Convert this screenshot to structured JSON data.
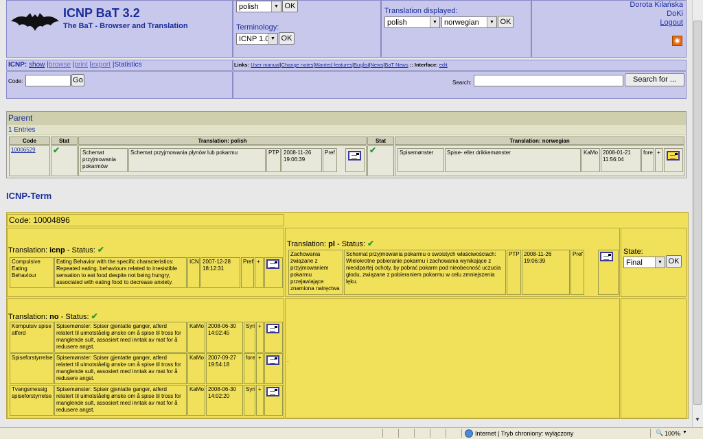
{
  "header": {
    "title": "ICNP BaT 3.2",
    "subtitle": "The BaT - Browser and Translation",
    "lang_select": "polish",
    "ok": "OK",
    "terminology_label": "Terminology:",
    "terminology_select": "ICNP 1.0",
    "translation_label": "Translation displayed:",
    "trans_sel1": "polish",
    "trans_sel2": "norwegian",
    "user_name": "Dorota Kilańska",
    "user_short": "DoKi",
    "logout": "Logout"
  },
  "nav": {
    "icnp": "ICNP:",
    "show": "show",
    "browse": "browse",
    "print": "print",
    "export": "export",
    "statistics": "Statistics",
    "links_label": "Links:",
    "user_manual": "User manual",
    "change_notes": "Change notes",
    "wanted": "Wanted features",
    "buglist": "Buglist",
    "news": "News",
    "bat_news": "BaT News",
    "interface_label": "Interface:",
    "edit": "edit",
    "sep": "|",
    "sep2": "::"
  },
  "search": {
    "code_label": "Code:",
    "go": "Go",
    "search_label": "Search:",
    "search_btn": "Search for ..."
  },
  "parent": {
    "title": "Parent",
    "entries": "1 Entries",
    "col_code": "Code",
    "col_stat": "Stat",
    "col_trans_pl": "Translation: polish",
    "col_trans_no": "Translation: norwegian",
    "code": "10006529",
    "pl": {
      "term": "Schemat przyjmowania pokarmów",
      "def": "Schemat przyjmowania płynów lub pokarmu",
      "user": "PTP",
      "date": "2008-11-26 19:06:39",
      "type": "Pref"
    },
    "no": {
      "term": "Spisemønster",
      "def": "Spise- eller drikkemønster",
      "user": "KaMo",
      "date": "2008-01-21 11:56:04",
      "type": "fore",
      "plus": "+"
    }
  },
  "term": {
    "heading": "ICNP-Term",
    "code_label": "Code: 10004896",
    "state_label": "State:",
    "state_value": "Final",
    "ok": "OK",
    "status": "- Status:",
    "dot": ".",
    "icnp": {
      "prefix": "Translation:",
      "lang": "icnp",
      "term": "Compulsive Eating Behaviour",
      "def": "Eating Behavior with the specific characteristics: Repeated eating, behaviours related to irresistible sensation to eat food despite not being hungry, associated with eating food to decrease anxiety.",
      "user": "ICN",
      "date": "2007-12-28 18:12:31",
      "type": "Pref",
      "plus": "+"
    },
    "pl": {
      "prefix": "Translation:",
      "lang": "pl",
      "term": "Zachowania związane z przyjmowaniem pokarmu przejawiające znamiona natręctwa",
      "def": "Schemat przyjmowania pokarmu o swoistych właściwościach: Wielokrotne pobieranie pokarmu i zachowania wynikające z nieodpartej ochoty, by pobrać pokarm pod nieobecność uczucia głodu, związane z pobieraniem pokarmu w celu zmniejszenia lęku.",
      "user": "PTP",
      "date": "2008-11-26 19:06:39",
      "type": "Pref"
    },
    "no": {
      "prefix": "Translation:",
      "lang": "no",
      "rows": [
        {
          "term": "Kompulsiv spise atferd",
          "def": "Spisemønster: Spiser gjentatte ganger, atferd relatert til uimotståelig ønske om å spise til tross for manglende sult, assosiert med inntak av mat for å redusere angst.",
          "user": "KaMo",
          "date": "2008-06-30 14:02:45",
          "type": "Syn",
          "plus": "+"
        },
        {
          "term": "Spiseforstyrrelser",
          "def": "Spisemønster: Spiser gjentatte ganger, atferd relatert til uimotståelig ønske om å spise til tross for manglende sult, assosiert med inntak av mat for å redusere angst.",
          "user": "KaMo",
          "date": "2007-09-27 19:54:18",
          "type": "fore",
          "plus": "+"
        },
        {
          "term": "Tvangsmessig spiseforstyrrelse",
          "def": "Spisemønster: Spiser gjentatte ganger, atferd relatert til uimotståelig ønske om å spise til tross for manglende sult, assosiert med inntak av mat for å redusere angst.",
          "user": "KaMo",
          "date": "2008-06-30 14:02:20",
          "type": "Syn",
          "plus": "+"
        }
      ]
    }
  },
  "statusbar": {
    "zone": "Internet | Tryb chroniony: wyłączony",
    "zoom": "100%"
  }
}
